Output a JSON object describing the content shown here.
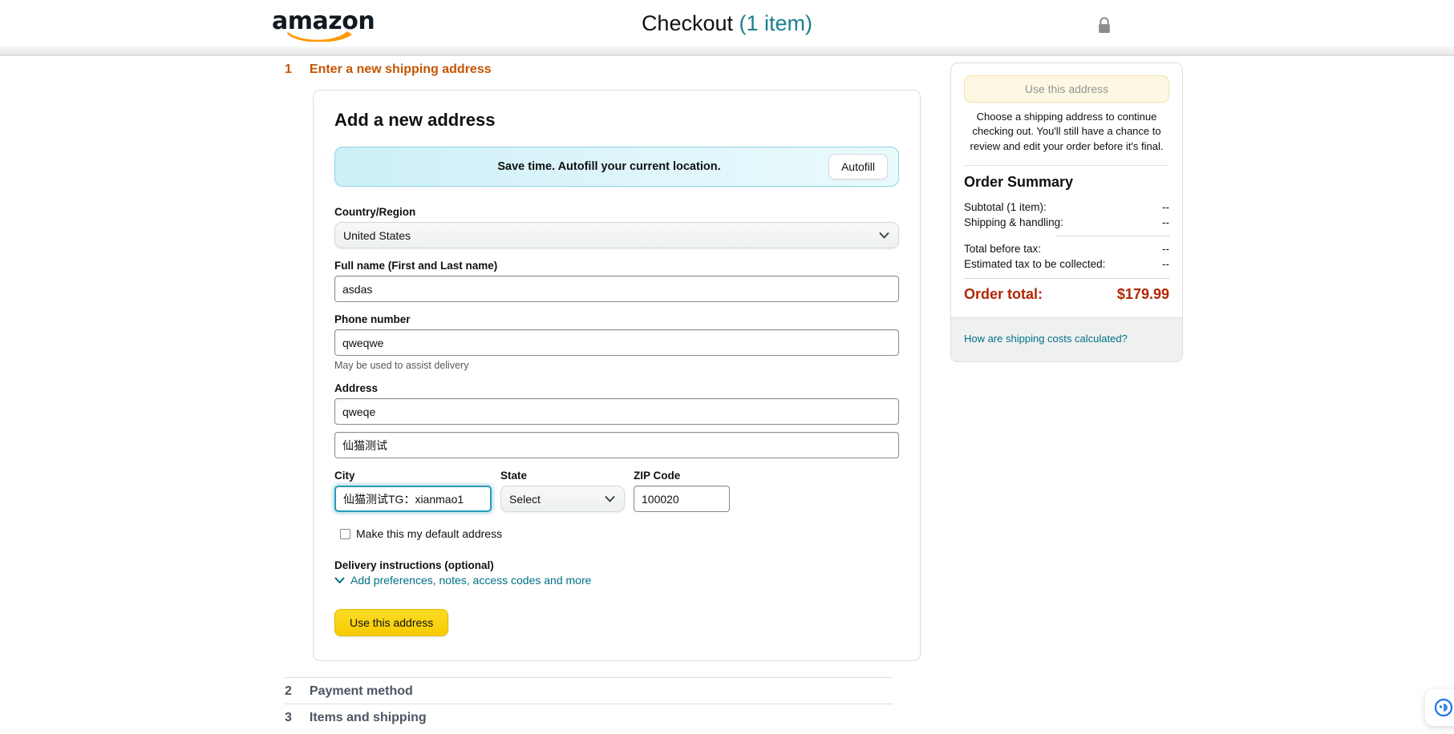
{
  "header": {
    "logo_text": "amazon",
    "logo_alt": "amazon-logo",
    "title": "Checkout",
    "item_count": "(1 item)",
    "lock_icon": "lock-icon"
  },
  "sections": [
    {
      "number": "1",
      "label": "Enter a new shipping address",
      "state": "active"
    },
    {
      "number": "2",
      "label": "Payment method",
      "state": "inactive"
    },
    {
      "number": "3",
      "label": "Items and shipping",
      "state": "inactive"
    }
  ],
  "address_form": {
    "card_title": "Add a new address",
    "autofill": {
      "message": "Save time. Autofill your current location.",
      "button_label": "Autofill"
    },
    "country": {
      "label": "Country/Region",
      "value": "United States",
      "caret_icon": "chevron-down-icon"
    },
    "full_name": {
      "label": "Full name (First and Last name)",
      "value": "asdas",
      "placeholder": ""
    },
    "phone": {
      "label": "Phone number",
      "value": "qweqwe",
      "placeholder": "",
      "helper": "May be used to assist delivery"
    },
    "address": {
      "label": "Address",
      "line1_value": "qweqe",
      "line1_placeholder": "",
      "line2_value": "仙猫测试",
      "line2_placeholder": ""
    },
    "city": {
      "label": "City",
      "value": "仙猫测试TG：xianmao1",
      "placeholder": "",
      "focused": true
    },
    "state": {
      "label": "State",
      "value": "Select",
      "caret_icon": "chevron-down-icon"
    },
    "zip": {
      "label": "ZIP Code",
      "value": "100020",
      "placeholder": ""
    },
    "default_address": {
      "label": "Make this my default address",
      "checked": false
    },
    "delivery_instructions": {
      "title": "Delivery instructions (optional)",
      "expander_label": "Add preferences, notes, access codes and more",
      "expander_icon": "chevron-down-icon"
    },
    "submit_label": "Use this address"
  },
  "summary": {
    "use_address_label": "Use this address",
    "blurb": "Choose a shipping address to continue checking out. You'll still have a chance to review and edit your order before it's final.",
    "title": "Order Summary",
    "lines": [
      {
        "label": "Subtotal (1 item):",
        "value": "--"
      },
      {
        "label": "Shipping & handling:",
        "value": "--"
      },
      {
        "label": "Total before tax:",
        "value": "--"
      },
      {
        "label": "Estimated tax to be collected:",
        "value": "--"
      }
    ],
    "order_total_label": "Order total:",
    "order_total_value": "$179.99",
    "shipping_link": "How are shipping costs calculated?"
  },
  "float_widget": {
    "icon": "chat-bubble-icon"
  },
  "colors": {
    "amazon_orange": "#c45500",
    "link_teal": "#007185",
    "title_teal": "#1b7f8f",
    "price_red": "#b12704",
    "button_yellow": "#f7ca00",
    "focus_teal": "#2a9cb8"
  }
}
